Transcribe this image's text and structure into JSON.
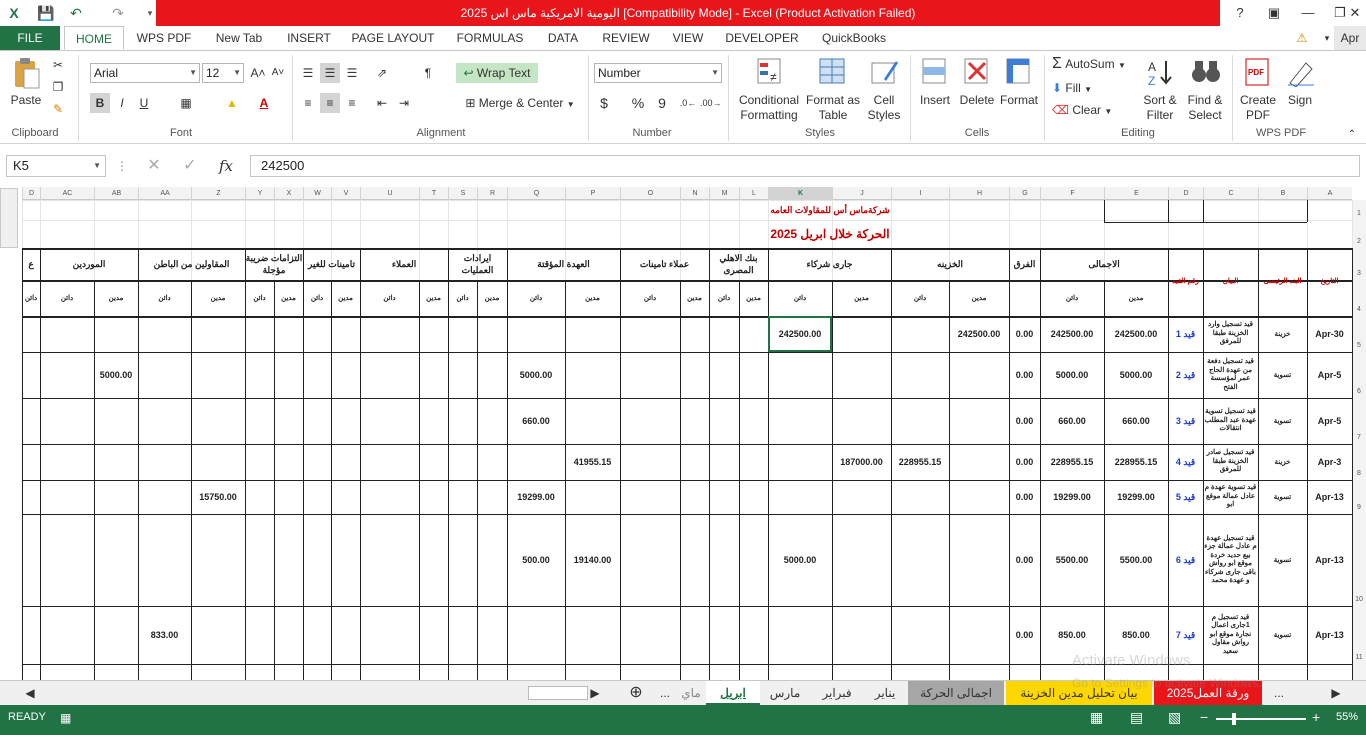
{
  "app": {
    "title": "اليومية الامريكية ماس اس 2025  [Compatibility Mode] -  Excel (Product Activation Failed)",
    "help": "?",
    "user_initial": "Apr"
  },
  "tabs": [
    "FILE",
    "HOME",
    "WPS PDF",
    "New Tab",
    "INSERT",
    "PAGE LAYOUT",
    "FORMULAS",
    "DATA",
    "REVIEW",
    "VIEW",
    "DEVELOPER",
    "QuickBooks"
  ],
  "ribbon": {
    "clipboard": {
      "label": "Clipboard",
      "paste": "Paste"
    },
    "font": {
      "label": "Font",
      "name": "Arial",
      "size": "12",
      "bold": "B",
      "italic": "I",
      "underline": "U"
    },
    "alignment": {
      "label": "Alignment",
      "wrap": "Wrap Text",
      "merge": "Merge & Center"
    },
    "number": {
      "label": "Number",
      "format": "Number",
      "currency": "$",
      "percent": "%",
      "comma": "9"
    },
    "styles": {
      "label": "Styles",
      "conditional": "Conditional Formatting",
      "format_as": "Format as Table",
      "cell_styles": "Cell Styles"
    },
    "cells": {
      "label": "Cells",
      "insert": "Insert",
      "delete": "Delete",
      "format": "Format"
    },
    "editing": {
      "label": "Editing",
      "autosum": "AutoSum",
      "fill": "Fill",
      "clear": "Clear",
      "sort": "Sort & Filter",
      "find": "Find & Select"
    },
    "wps": {
      "label": "WPS PDF",
      "create": "Create PDF",
      "sign": "Sign"
    }
  },
  "formula_bar": {
    "name": "K5",
    "fx": "fx",
    "value": "242500"
  },
  "columns": [
    "A",
    "B",
    "C",
    "D",
    "E",
    "F",
    "G",
    "H",
    "I",
    "J",
    "K",
    "L",
    "M",
    "N",
    "O",
    "P",
    "Q",
    "R",
    "S",
    "T",
    "U",
    "V",
    "W",
    "X",
    "Y",
    "Z",
    "AA",
    "AB",
    "AC",
    "D"
  ],
  "rows": [
    "1",
    "2",
    "3",
    "4",
    "5",
    "6",
    "7",
    "8",
    "9",
    "10",
    "11"
  ],
  "sheet": {
    "company": "شركةماس أس للمقاولات العامه",
    "period": "الحركة خلال ابريل 2025",
    "headers": {
      "date": "التاريخ",
      "main_item": "البند الرئيسى",
      "statement": "البيان",
      "entry_no": "رقم القيد",
      "total": "الاجمالى",
      "diff": "الفرق",
      "treasury": "الخزينه",
      "partners": "جارى شركاء",
      "bank": "بنك الاهلي المصرى",
      "insurance_clients": "عملاء تامينات",
      "custody": "العهدة المؤقتة",
      "operations_revenue": "ايرادات العمليات",
      "clients": "العملاء",
      "insurance_others": "تامينات للغير",
      "tax_commitments": "التزامات ضريبة مؤجلة",
      "subcontractors": "المقاولين من الباطن",
      "suppliers": "الموردين",
      "debit": "مدين",
      "credit": "دائن",
      "last": "ع"
    },
    "entries": [
      {
        "date": "Apr-30",
        "item": "خزينة",
        "desc": "قيد تسجيل وارد الخزينة طبقا للمرفق",
        "no": "قيد 1",
        "t_debit": "242500.00",
        "t_credit": "242500.00",
        "diff": "0.00",
        "tr_debit": "242500.00",
        "tr_credit": "",
        "p_debit": "",
        "p_credit": "242500.00",
        "cu_debit": "",
        "cu_credit": "",
        "sub_debit": "",
        "sub_credit": "",
        "sup_debit": "",
        "sup_credit": ""
      },
      {
        "date": "Apr-5",
        "item": "تسوية",
        "desc": "قيد تسجيل دفعة من عهدة الحاج عمر لمؤسسة الفتح",
        "no": "قيد 2",
        "t_debit": "5000.00",
        "t_credit": "5000.00",
        "diff": "0.00",
        "tr_debit": "",
        "tr_credit": "",
        "p_debit": "",
        "p_credit": "",
        "cu_debit": "",
        "cu_credit": "5000.00",
        "sub_debit": "",
        "sub_credit": "",
        "sup_debit": "5000.00",
        "sup_credit": ""
      },
      {
        "date": "Apr-5",
        "item": "تسوية",
        "desc": "قيد تسجيل تسوية عهدة عبد المطلب انتقالات",
        "no": "قيد 3",
        "t_debit": "660.00",
        "t_credit": "660.00",
        "diff": "0.00",
        "tr_debit": "",
        "tr_credit": "",
        "p_debit": "",
        "p_credit": "",
        "cu_debit": "",
        "cu_credit": "660.00",
        "sub_debit": "",
        "sub_credit": "",
        "sup_debit": "",
        "sup_credit": ""
      },
      {
        "date": "Apr-3",
        "item": "خزينة",
        "desc": "قيد تسجيل صادر الخزينة طبقا للمرفق",
        "no": "قيد 4",
        "t_debit": "228955.15",
        "t_credit": "228955.15",
        "diff": "0.00",
        "tr_debit": "",
        "tr_credit": "228955.15",
        "p_debit": "187000.00",
        "p_credit": "",
        "cu_debit": "41955.15",
        "cu_credit": "",
        "sub_debit": "",
        "sub_credit": "",
        "sup_debit": "",
        "sup_credit": ""
      },
      {
        "date": "Apr-13",
        "item": "تسوية",
        "desc": "قيد تسوية عهدة م عادل عمالة موقع ابو",
        "no": "قيد 5",
        "t_debit": "19299.00",
        "t_credit": "19299.00",
        "diff": "0.00",
        "tr_debit": "",
        "tr_credit": "",
        "p_debit": "",
        "p_credit": "",
        "cu_debit": "",
        "cu_credit": "19299.00",
        "sub_debit": "15750.00",
        "sub_credit": "",
        "sup_debit": "",
        "sup_credit": ""
      },
      {
        "date": "Apr-13",
        "item": "تسوية",
        "desc": "قيد تسجيل عهدة م عادل عمالة جزء بيع حديد خردة موقع ابو رواش باقى جارى شركاء و عهدة محمد",
        "no": "قيد 6",
        "t_debit": "5500.00",
        "t_credit": "5500.00",
        "diff": "0.00",
        "tr_debit": "",
        "tr_credit": "",
        "p_debit": "",
        "p_credit": "5000.00",
        "cu_debit": "19140.00",
        "cu_credit": "500.00",
        "sub_debit": "",
        "sub_credit": "",
        "sup_debit": "",
        "sup_credit": ""
      },
      {
        "date": "Apr-13",
        "item": "تسوية",
        "desc": "قيد تسجيل م 1جارى اعمال نجارة موقع ابو رواش مقاول سعيد",
        "no": "قيد 7",
        "t_debit": "850.00",
        "t_credit": "850.00",
        "diff": "0.00",
        "tr_debit": "",
        "tr_credit": "",
        "p_debit": "",
        "p_credit": "",
        "cu_debit": "",
        "cu_credit": "",
        "sub_debit": "",
        "sub_credit": "833.00",
        "sup_debit": "",
        "sup_credit": ""
      }
    ]
  },
  "sheet_tabs": [
    "ورقة العمل2025",
    "بيان تحليل مدين الخزينة",
    "اجمالى الحركة",
    "يناير",
    "فبراير",
    "مارس",
    "ابريل",
    "ماي",
    "..."
  ],
  "status": {
    "ready": "READY",
    "zoom": "55%"
  },
  "watermark": {
    "line1": "Activate Windows",
    "line2": "Go to Settings to activate Windows."
  }
}
